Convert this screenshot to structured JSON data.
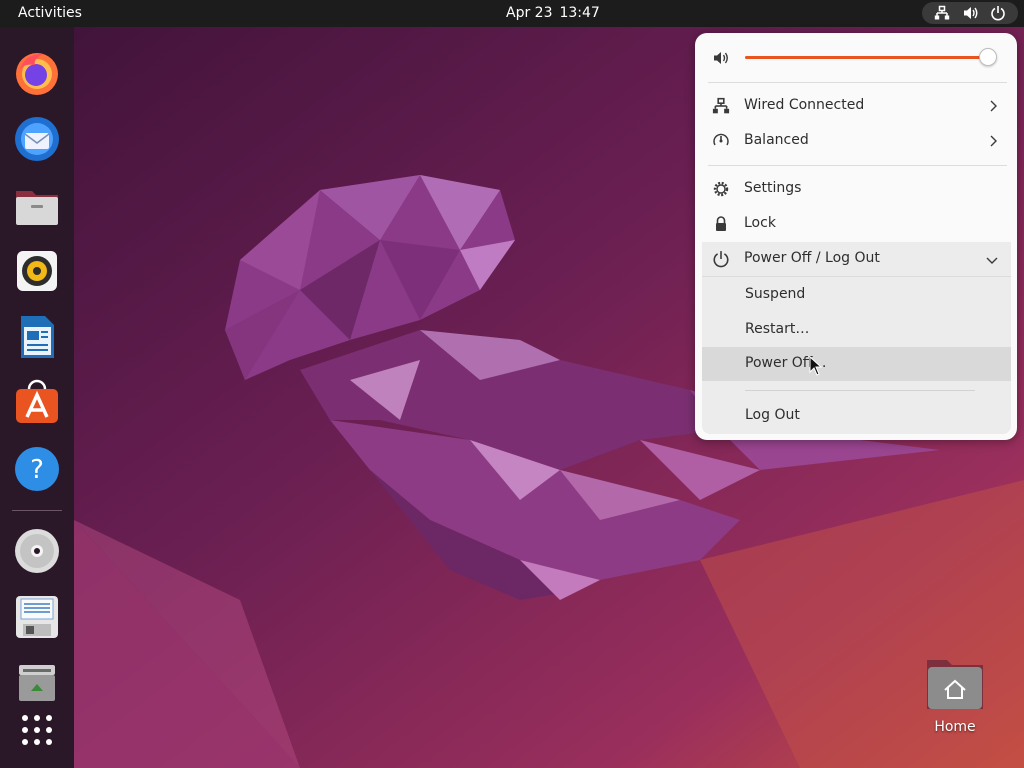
{
  "topbar": {
    "activities_label": "Activities",
    "date": "Apr 23",
    "time": "13:47",
    "tray_icons": [
      "network-wired-icon",
      "volume-icon",
      "power-icon"
    ]
  },
  "dock": {
    "apps": [
      {
        "name": "Firefox",
        "icon": "firefox-icon"
      },
      {
        "name": "Thunderbird Mail",
        "icon": "thunderbird-icon"
      },
      {
        "name": "Files",
        "icon": "files-icon"
      },
      {
        "name": "Rhythmbox",
        "icon": "rhythmbox-icon"
      },
      {
        "name": "LibreOffice Writer",
        "icon": "libreoffice-writer-icon"
      },
      {
        "name": "Ubuntu Software",
        "icon": "ubuntu-software-icon"
      },
      {
        "name": "Help",
        "icon": "help-icon"
      },
      {
        "name": "Optical disc",
        "icon": "disc-icon"
      },
      {
        "name": "Floppy / drive",
        "icon": "drive-icon"
      },
      {
        "name": "Trash",
        "icon": "trash-icon"
      },
      {
        "name": "Show Applications",
        "icon": "app-grid-icon"
      }
    ]
  },
  "desktop": {
    "home_label": "Home"
  },
  "quick_menu": {
    "volume": {
      "level": 0.99,
      "icon": "speaker-icon"
    },
    "network_label": "Wired Connected",
    "power_mode_label": "Balanced",
    "settings_label": "Settings",
    "lock_label": "Lock",
    "power_section_label": "Power Off / Log Out",
    "power_items": {
      "suspend": "Suspend",
      "restart": "Restart…",
      "power_off": "Power Off…",
      "log_out": "Log Out"
    }
  },
  "colors": {
    "accent": "#e95420",
    "topbar": "#1c1c1c",
    "dock": "#2a1727",
    "menu_bg": "#fafafa",
    "wallpaper_base": "#5a1f4a"
  }
}
